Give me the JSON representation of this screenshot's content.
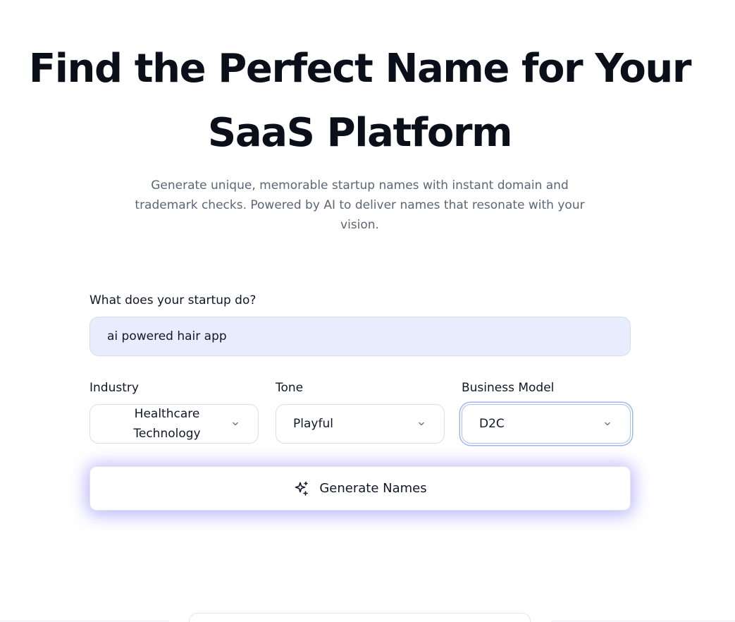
{
  "hero": {
    "title_line1": "Find the Perfect Name for Your",
    "title_line2": "SaaS Platform",
    "subtitle": "Generate unique, memorable startup names with instant domain and trademark checks. Powered by AI to deliver names that resonate with your vision."
  },
  "form": {
    "idea_label": "What does your startup do?",
    "idea_value": "ai powered hair app",
    "industry": {
      "label": "Industry",
      "value": "Healthcare Technology",
      "icon": "chevron-down-icon"
    },
    "tone": {
      "label": "Tone",
      "value": "Playful",
      "icon": "chevron-down-icon"
    },
    "business_model": {
      "label": "Business Model",
      "value": "D2C",
      "icon": "chevron-down-icon"
    },
    "generate_button": {
      "label": "Generate Names",
      "icon": "sparkles-icon"
    }
  },
  "colors": {
    "input_background": "#e8edfd",
    "focus_ring": "#9fb7ef",
    "glow": "#a78bfa",
    "subtitle_text": "#5b6677"
  }
}
